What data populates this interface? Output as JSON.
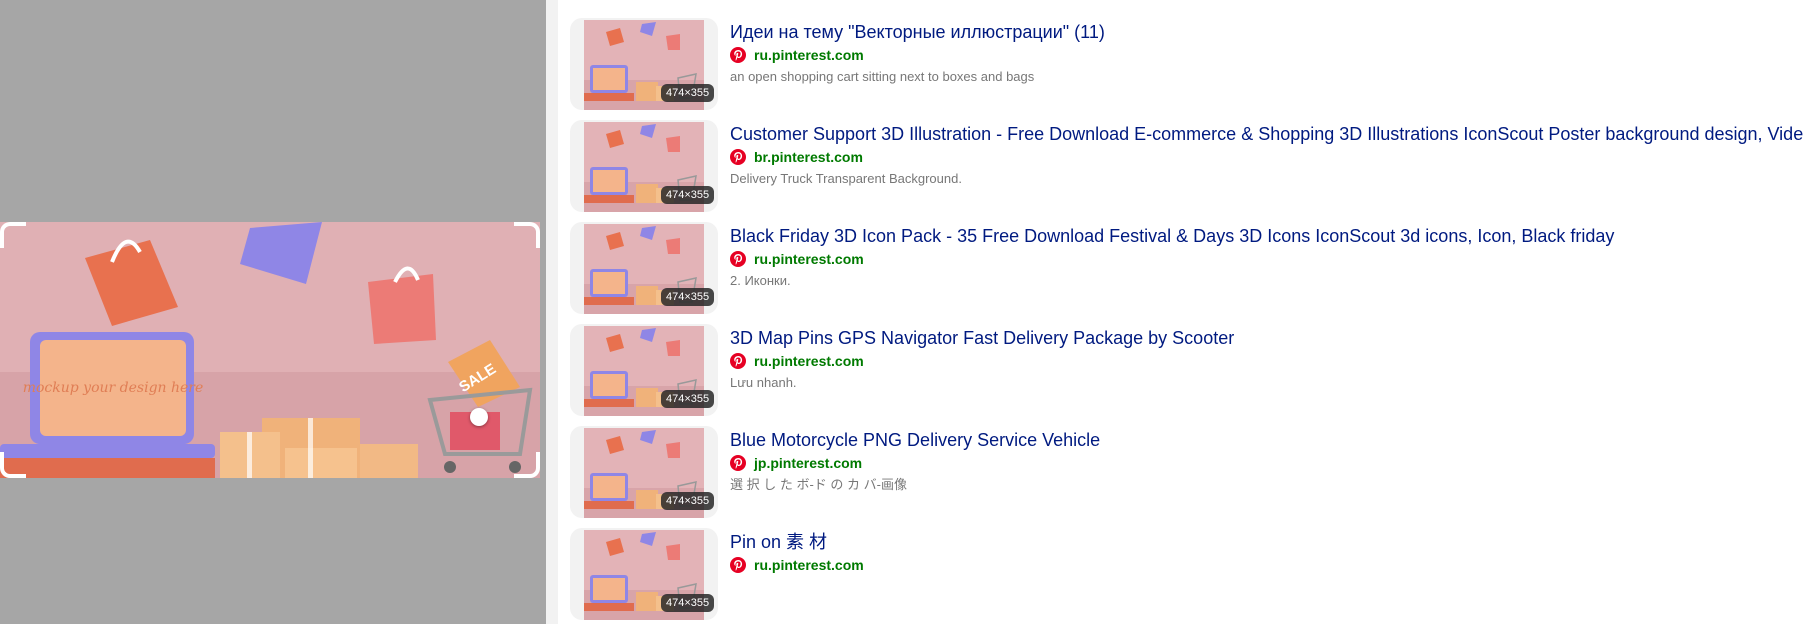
{
  "results": [
    {
      "title": "Идеи на тему \"Векторные иллюстрации\" (11)",
      "source": "ru.pinterest.com",
      "description": "an open shopping cart sitting next to boxes and bags",
      "size": "474×355"
    },
    {
      "title": "Customer Support 3D Illustration - Free Download E-commerce & Shopping 3D Illustrations IconScout Poster background design, Vide",
      "source": "br.pinterest.com",
      "description": "Delivery Truck Transparent Background.",
      "size": "474×355"
    },
    {
      "title": "Black Friday 3D Icon Pack - 35 Free Download Festival & Days 3D Icons IconScout 3d icons, Icon, Black friday",
      "source": "ru.pinterest.com",
      "description": "2. Иконки.",
      "size": "474×355"
    },
    {
      "title": "3D Map Pins GPS Navigator Fast Delivery Package by Scooter",
      "source": "ru.pinterest.com",
      "description": "Lưu nhanh.",
      "size": "474×355"
    },
    {
      "title": "Blue Motorcycle PNG Delivery Service Vehicle",
      "source": "jp.pinterest.com",
      "description": "選 択 し た ボ-ド の カ バ-画像",
      "size": "474×355"
    },
    {
      "title": "Pin on 素 材",
      "source": "ru.pinterest.com",
      "description": "",
      "size": "474×355"
    }
  ],
  "preview": {
    "laptop_text": "mockup your design here",
    "sale_tag": "SALE"
  },
  "icons": {
    "source": "pinterest-icon"
  },
  "colors": {
    "title_link": "#001a80",
    "domain": "#007a00",
    "description": "#777777",
    "pinterest": "#e60023",
    "left_background": "#a6a6a6",
    "preview_wall": "#e0b0b4"
  }
}
